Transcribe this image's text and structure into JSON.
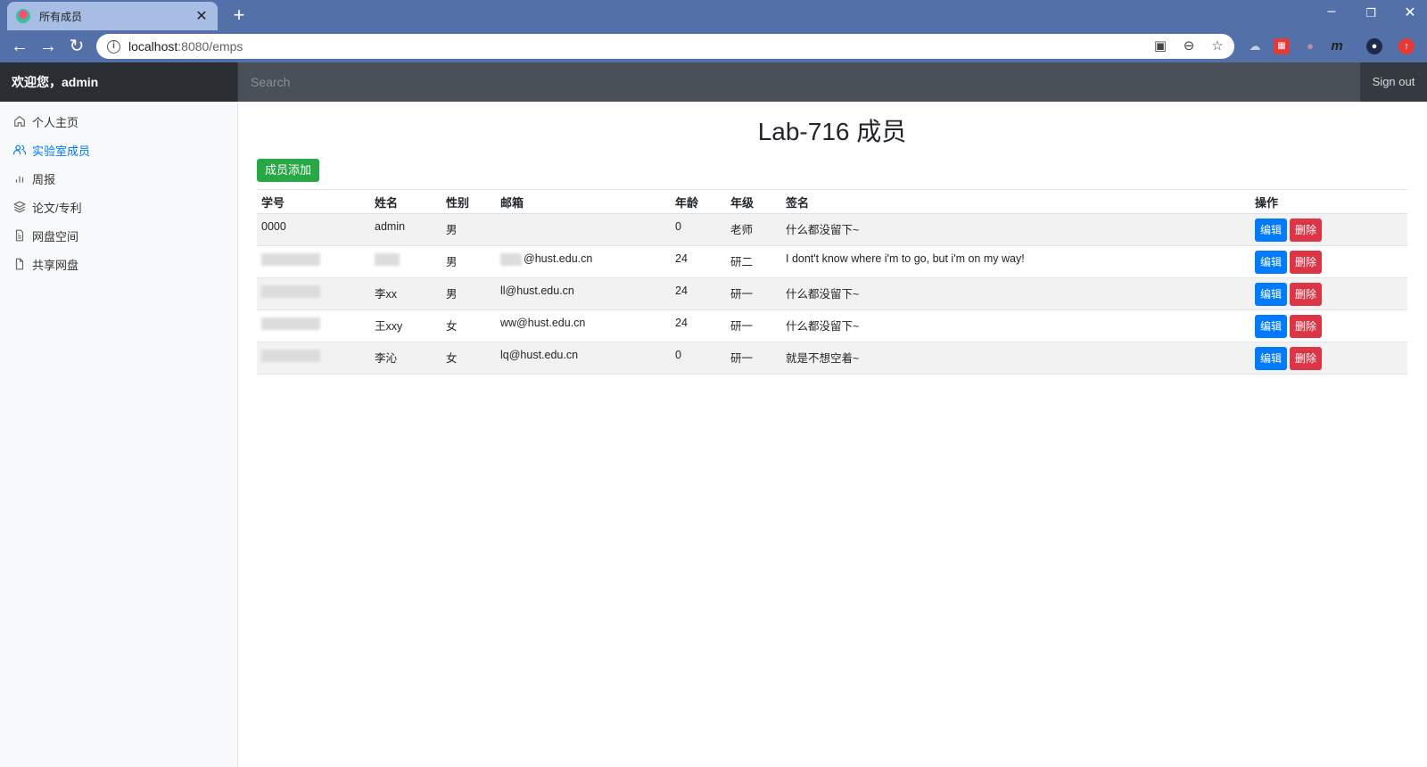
{
  "browser": {
    "tab_title": "所有成员",
    "url_host": "localhost",
    "url_rest": ":8080/emps"
  },
  "header": {
    "brand": "欢迎您，admin",
    "search_placeholder": "Search",
    "signout": "Sign out"
  },
  "sidebar": {
    "items": [
      {
        "label": "个人主页",
        "icon": "home-icon"
      },
      {
        "label": "实验室成员",
        "icon": "users-icon"
      },
      {
        "label": "周报",
        "icon": "bar-chart-icon"
      },
      {
        "label": "论文/专利",
        "icon": "layers-icon"
      },
      {
        "label": "网盘空间",
        "icon": "file-text-icon"
      },
      {
        "label": "共享网盘",
        "icon": "file-icon"
      }
    ]
  },
  "main": {
    "title": "Lab-716 成员",
    "add_button": "成员添加",
    "columns": [
      "学号",
      "姓名",
      "性别",
      "邮箱",
      "年龄",
      "年级",
      "签名",
      "操作"
    ],
    "rows": [
      {
        "id": "0000",
        "name": "admin",
        "gender": "男",
        "email": "",
        "age": "0",
        "grade": "老师",
        "sign": "什么都没留下~"
      },
      {
        "id": "",
        "name": "",
        "gender": "男",
        "email": "@hust.edu.cn",
        "age": "24",
        "grade": "研二",
        "sign": "I dont't know where i'm to go, but i'm on my way!"
      },
      {
        "id": "",
        "name": "李xx",
        "gender": "男",
        "email": "ll@hust.edu.cn",
        "age": "24",
        "grade": "研一",
        "sign": "什么都没留下~"
      },
      {
        "id": "",
        "name": "王xxy",
        "gender": "女",
        "email": "ww@hust.edu.cn",
        "age": "24",
        "grade": "研一",
        "sign": "什么都没留下~"
      },
      {
        "id": "",
        "name": "李沁",
        "gender": "女",
        "email": "lq@hust.edu.cn",
        "age": "0",
        "grade": "研一",
        "sign": "就是不想空着~"
      }
    ],
    "edit_label": "编辑",
    "delete_label": "删除"
  },
  "colors": {
    "chrome": "#5470a8",
    "navbar": "#343a40",
    "primary": "#007bff",
    "success": "#28a745",
    "danger": "#dc3545"
  }
}
